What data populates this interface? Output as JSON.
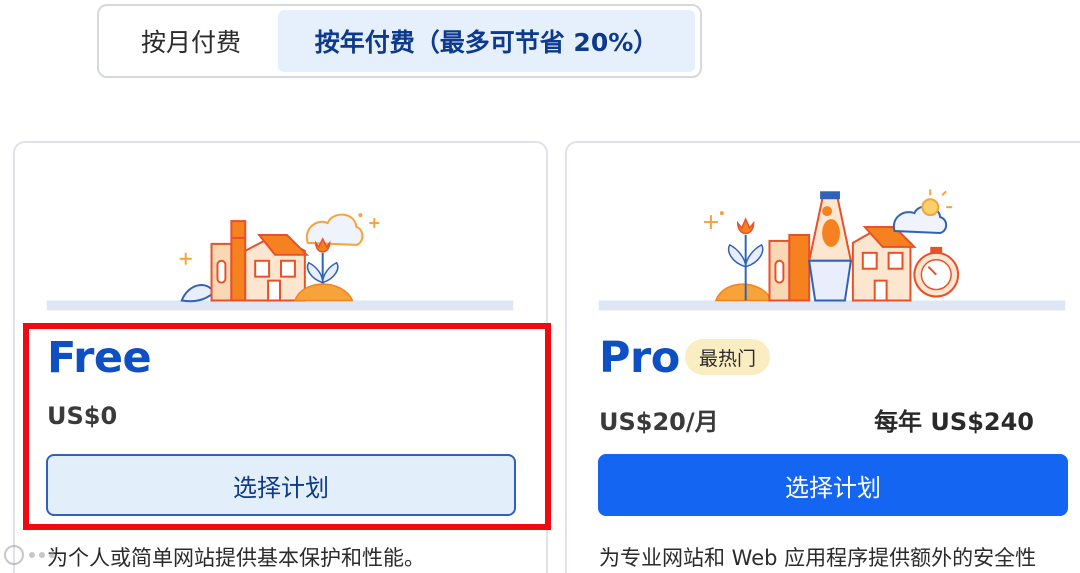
{
  "billing_toggle": {
    "monthly_label": "按月付费",
    "annual_label": "按年付费（最多可节省 20%）"
  },
  "plans": [
    {
      "name": "Free",
      "price": "US$0",
      "button_label": "选择计划",
      "description": "为个人或简单网站提供基本保护和性能。"
    },
    {
      "name": "Pro",
      "badge": "最热门",
      "price": "US$20/月",
      "annual_price": "每年 US$240",
      "button_label": "选择计划",
      "description": "为专业网站和 Web 应用程序提供额外的安全性"
    }
  ],
  "colors": {
    "accent_blue": "#1466f2",
    "plan_name_blue": "#0f4fc4",
    "highlight_red": "#ee0a10",
    "badge_yellow": "#fbedc2",
    "illustration_orange": "#f6821f"
  },
  "icons": [
    "free-plan-illustration",
    "pro-plan-illustration",
    "watermark-logo"
  ]
}
